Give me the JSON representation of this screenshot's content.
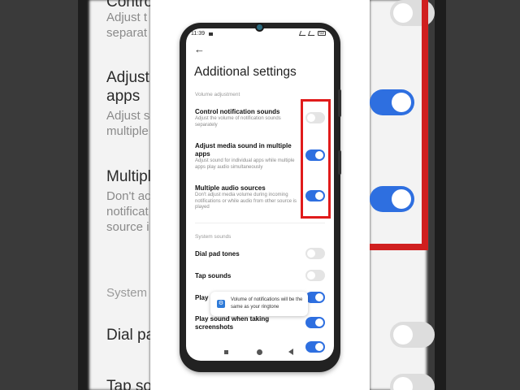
{
  "status_bar": {
    "time": "11:39",
    "battery": "69"
  },
  "page": {
    "title": "Additional settings",
    "back_label": "←"
  },
  "volume_adjustment": {
    "header": "Volume adjustment",
    "items": [
      {
        "label": "Control notification sounds",
        "description": "Adjust the volume of notification sounds separately",
        "enabled": false
      },
      {
        "label": "Adjust media sound in multiple apps",
        "description": "Adjust sound for individual apps while multiple apps play audio simultaneously",
        "enabled": true
      },
      {
        "label": "Multiple audio sources",
        "description": "Don't adjust media volume during incoming notifications or while audio from other source is played",
        "enabled": true
      }
    ]
  },
  "system_sounds": {
    "header": "System sounds",
    "items": [
      {
        "label": "Dial pad tones",
        "enabled": false
      },
      {
        "label": "Tap sounds",
        "enabled": false
      },
      {
        "label": "Play",
        "enabled": true
      },
      {
        "label": "Play sound when taking screenshots",
        "enabled": true
      }
    ]
  },
  "toast": {
    "message": "Volume of notifications will be the same as your ringtone"
  },
  "background": {
    "left_texts": {
      "t1": "Contro",
      "t1_sub1": "Adjust t",
      "t1_sub2": "separat",
      "t2a": "Adjust",
      "t2b": "apps",
      "t2_sub1": "Adjust s",
      "t2_sub2": "multiple",
      "t3": "Multipl",
      "t3_sub1": "Don't ac",
      "t3_sub2": "notificat",
      "t3_sub3": "source i",
      "t4": "System",
      "t5": "Dial pa",
      "t6": "Tap so"
    }
  },
  "colors": {
    "accent": "#2e6fe0",
    "highlight": "#e01b1b",
    "toggle_off": "#e4e4e4"
  }
}
